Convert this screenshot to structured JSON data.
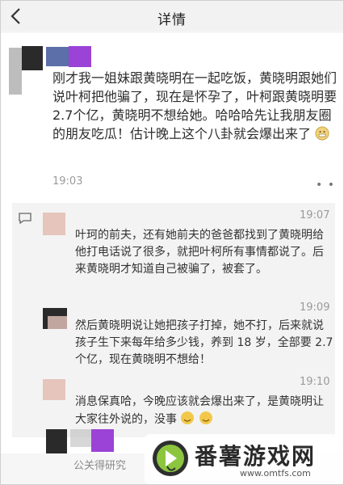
{
  "header": {
    "title": "详情",
    "back_icon": "chevron-left-icon"
  },
  "post": {
    "text": "刚才我一姐妹跟黄晓明在一起吃饭，黄晓明跟她们说叶柯把他骗了，现在是怀孕了，叶柯跟黄晓明要 2.7个亿，黄晓明不想给她。哈哈哈先让我朋友圈的朋友吃瓜！估计晚上这个八卦就会爆出来了",
    "time": "19:03",
    "more": "• •"
  },
  "comments": [
    {
      "time": "19:07",
      "text": "叶珂的前夫，还有她前夫的爸爸都找到了黄晓明给他打电话说了很多，就把叶柯所有事情都说了。后来黄晓明才知道自己被骗了，被套了。"
    },
    {
      "time": "19:09",
      "text": "然后黄晓明说让她把孩子打掉，她不打，后来就说孩子生下来每年给多少钱，养到 18 岁，全部要 2.7个亿，现在黄晓明不想给！"
    },
    {
      "time": "19:10",
      "text": "消息保真哈，今晚应该就会爆出来了，是黄晓明让大家往外说的，没事"
    }
  ],
  "footer": {
    "text": "公关得研究"
  },
  "watermark": {
    "name": "番薯游戏网",
    "url": "www.omtfs.com"
  }
}
